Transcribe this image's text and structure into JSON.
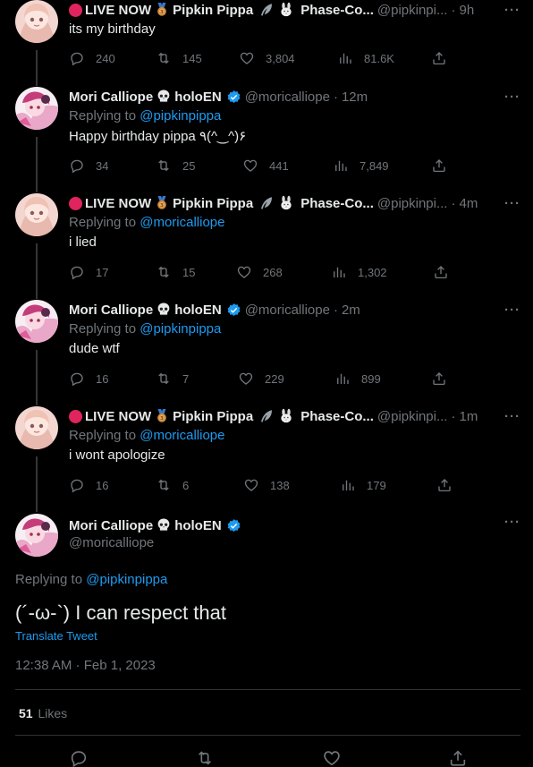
{
  "tweets": [
    {
      "name": "LIVE NOW",
      "name2": "Pipkin Pippa",
      "name3": "Phase-Co...",
      "handle": "@pipkinpi...",
      "time": "9h",
      "replying_prefix": "",
      "replying_to": "",
      "text": "its my birthday",
      "replies": "240",
      "retweets": "145",
      "likes": "3,804",
      "views": "81.6K"
    },
    {
      "name": "Mori Calliope",
      "name2": "holoEN",
      "handle": "@moricalliope",
      "time": "12m",
      "replying_prefix": "Replying to",
      "replying_to": "@pipkinpippa",
      "text": "Happy birthday pippa ٩(^‿^)۶",
      "replies": "34",
      "retweets": "25",
      "likes": "441",
      "views": "7,849"
    },
    {
      "name": "LIVE NOW",
      "name2": "Pipkin Pippa",
      "name3": "Phase-Co...",
      "handle": "@pipkinpi...",
      "time": "4m",
      "replying_prefix": "Replying to",
      "replying_to": "@moricalliope",
      "text": "i lied",
      "replies": "17",
      "retweets": "15",
      "likes": "268",
      "views": "1,302"
    },
    {
      "name": "Mori Calliope",
      "name2": "holoEN",
      "handle": "@moricalliope",
      "time": "2m",
      "replying_prefix": "Replying to",
      "replying_to": "@pipkinpippa",
      "text": "dude wtf",
      "replies": "16",
      "retweets": "7",
      "likes": "229",
      "views": "899"
    },
    {
      "name": "LIVE NOW",
      "name2": "Pipkin Pippa",
      "name3": "Phase-Co...",
      "handle": "@pipkinpi...",
      "time": "1m",
      "replying_prefix": "Replying to",
      "replying_to": "@moricalliope",
      "text": "i wont apologize",
      "replies": "16",
      "retweets": "6",
      "likes": "138",
      "views": "179"
    }
  ],
  "main": {
    "name": "Mori Calliope",
    "name2": "holoEN",
    "handle": "@moricalliope",
    "replying_prefix": "Replying to",
    "replying_to": "@pipkinpippa",
    "text": "(´-ω-`) I can respect that",
    "translate": "Translate Tweet",
    "timestamp": "12:38 AM · Feb 1, 2023",
    "likes_count": "51",
    "likes_label": "Likes"
  },
  "ui": {
    "more": "···",
    "dot": "·"
  },
  "colors": {
    "accent": "#1d9bf0",
    "muted": "#71767b",
    "live_red": "#e0245e"
  }
}
